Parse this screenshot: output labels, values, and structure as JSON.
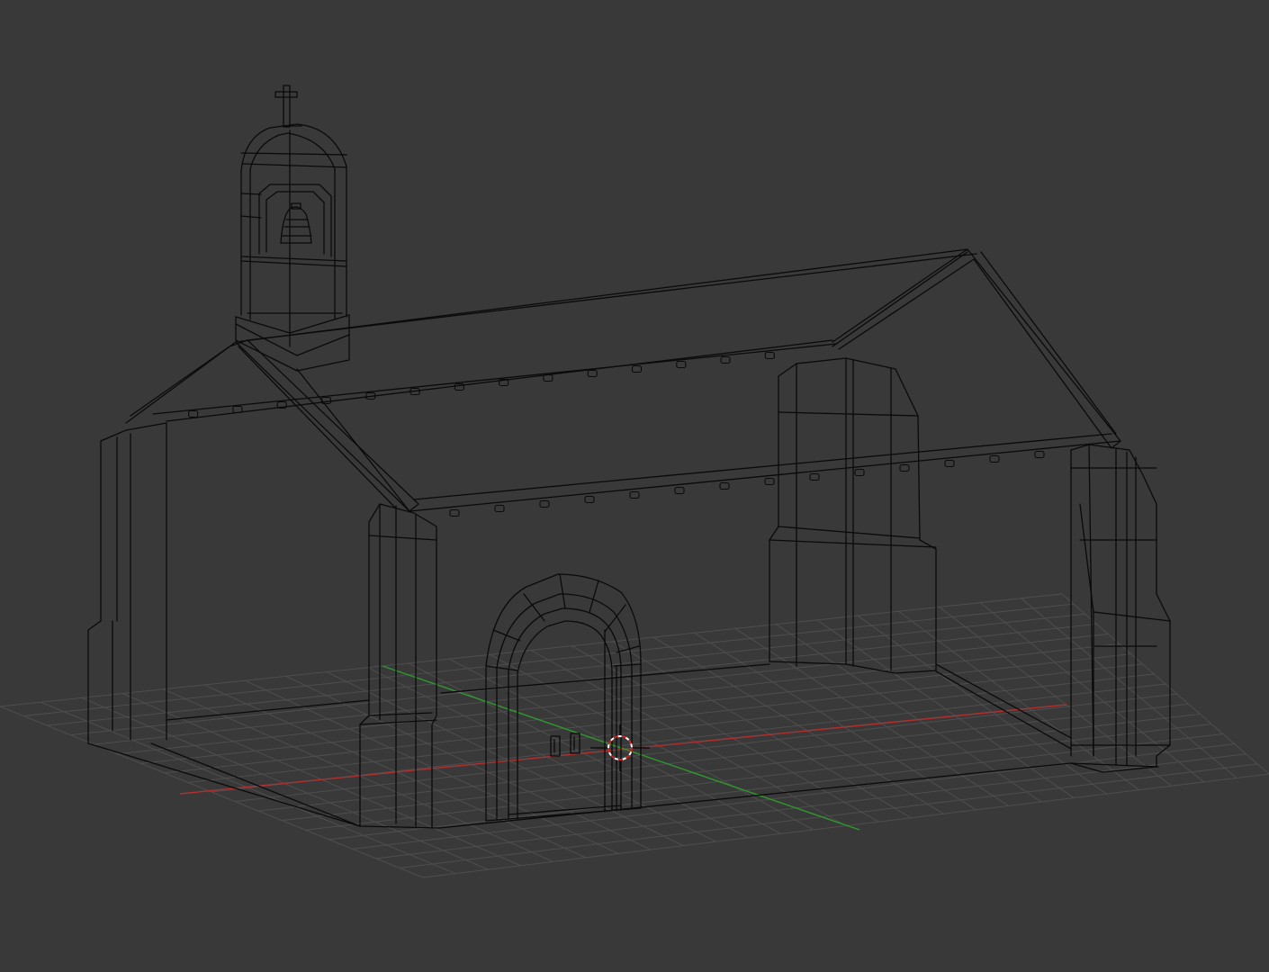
{
  "viewport": {
    "background_color": "#393939",
    "grid_color": "#4e4e4e",
    "wire_color": "#0a0a0a",
    "x_axis_color": "#b03030",
    "y_axis_color": "#2e9a2e",
    "cursor_colors": [
      "#d42020",
      "#ffffff"
    ]
  },
  "scene": {
    "display_mode": "wireframe",
    "objects": [
      "chapel-walls",
      "gable-roof",
      "bell-tower",
      "bell",
      "cross",
      "arched-doorway",
      "buttresses",
      "roof-corbels",
      "door-handles"
    ]
  },
  "icons": {
    "cursor": "3d-cursor-icon"
  }
}
